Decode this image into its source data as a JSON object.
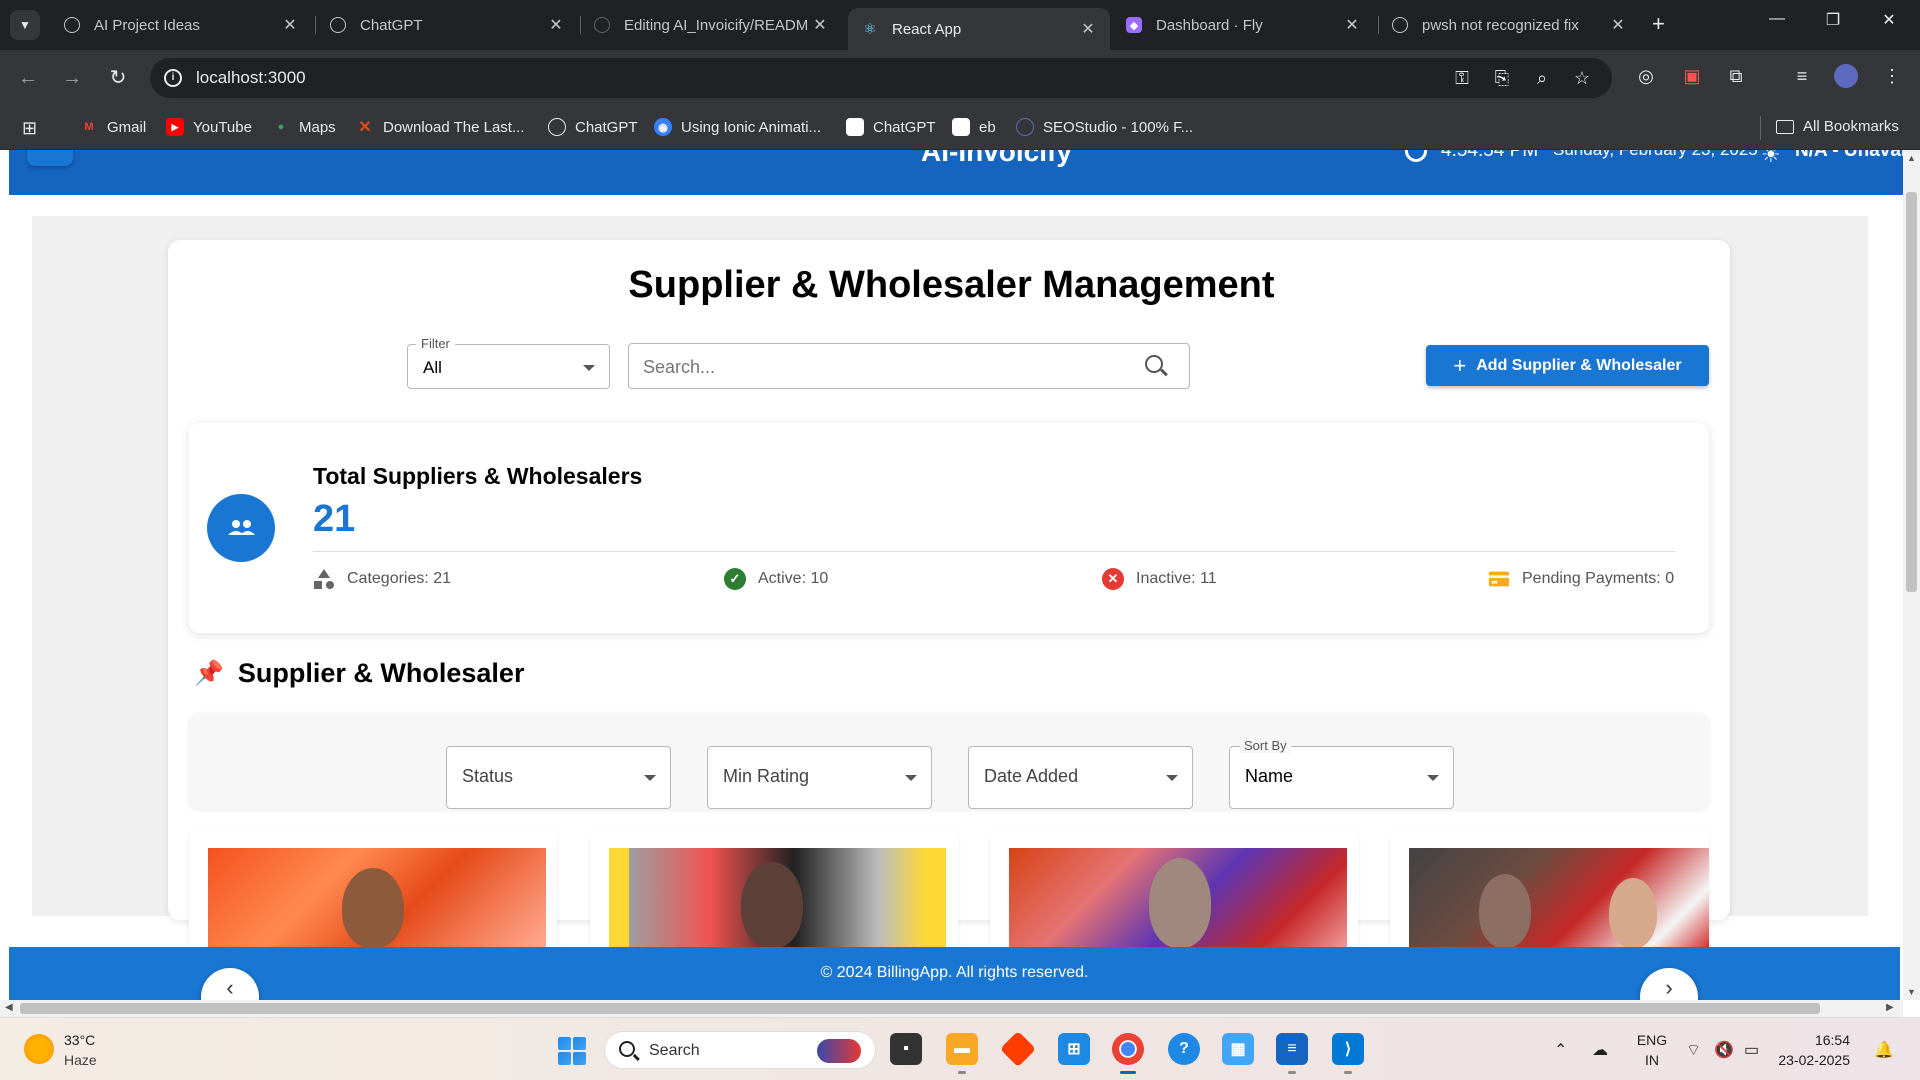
{
  "browser": {
    "tabs": [
      {
        "title": "AI Project Ideas",
        "icon": "chatgpt-icon",
        "active": false
      },
      {
        "title": "ChatGPT",
        "icon": "chatgpt-icon",
        "active": false
      },
      {
        "title": "Editing AI_Invoicify/READM",
        "icon": "github-icon",
        "active": false
      },
      {
        "title": "React App",
        "icon": "react-icon",
        "active": true
      },
      {
        "title": "Dashboard · Fly",
        "icon": "fly-icon",
        "active": false
      },
      {
        "title": "pwsh not recognized fix",
        "icon": "chatgpt-icon",
        "active": false
      }
    ],
    "url": "localhost:3000",
    "bookmarks": [
      {
        "label": "Gmail",
        "icon": "gmail-icon"
      },
      {
        "label": "YouTube",
        "icon": "youtube-icon"
      },
      {
        "label": "Maps",
        "icon": "maps-icon"
      },
      {
        "label": "Download The Last...",
        "icon": "x-icon"
      },
      {
        "label": "ChatGPT",
        "icon": "chatgpt-icon"
      },
      {
        "label": "Using Ionic Animati...",
        "icon": "ionic-icon"
      },
      {
        "label": "ChatGPT",
        "icon": "chatgpt-icon"
      },
      {
        "label": "eb",
        "icon": "chatgpt-icon"
      },
      {
        "label": "SEOStudio - 100% F...",
        "icon": "seostudio-icon"
      }
    ],
    "all_bookmarks_label": "All Bookmarks"
  },
  "app_header": {
    "title": "AI-Invoicify",
    "time": "4:54:54 PM",
    "date": "Sunday, February 23, 2025",
    "weather": "N/A - Unavaila"
  },
  "page": {
    "title": "Supplier & Wholesaler Management",
    "filter": {
      "label": "Filter",
      "value": "All"
    },
    "search": {
      "placeholder": "Search..."
    },
    "add_button": "Add Supplier & Wholesaler"
  },
  "stats": {
    "title": "Total Suppliers & Wholesalers",
    "count": "21",
    "categories": "Categories: 21",
    "active": "Active: 10",
    "inactive": "Inactive: 11",
    "pending": "Pending Payments: 0"
  },
  "section": {
    "title": "Supplier & Wholesaler",
    "filters": {
      "status": "Status",
      "min_rating": "Min Rating",
      "date_added": "Date Added",
      "sort_label": "Sort By",
      "sort_value": "Name"
    }
  },
  "footer": {
    "text": "© 2024 BillingApp. All rights reserved."
  },
  "taskbar": {
    "temperature": "33°C",
    "condition": "Haze",
    "search_label": "Search",
    "lang_1": "ENG",
    "lang_2": "IN",
    "time": "16:54",
    "date": "23-02-2025"
  },
  "colors": {
    "primary": "#1976d2",
    "header": "#1565c0",
    "active_green": "#2e7d32",
    "inactive_red": "#e53935",
    "pending_amber": "#f9a825"
  }
}
